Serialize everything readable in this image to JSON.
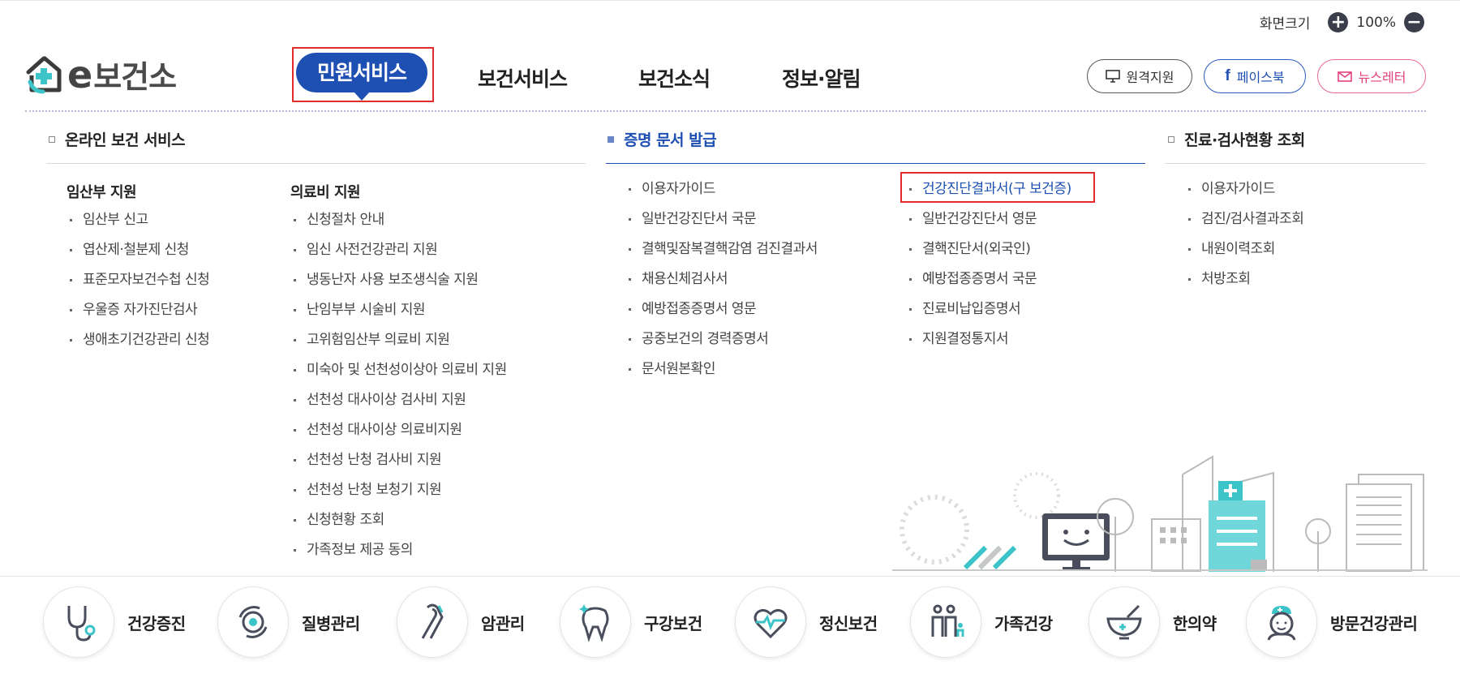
{
  "zoom": {
    "label": "화면크기",
    "plus": "+",
    "value": "100%",
    "minus": "−"
  },
  "logo": {
    "e": "e",
    "text": "보건소"
  },
  "gnb": [
    {
      "label": "민원서비스"
    },
    {
      "label": "보건서비스"
    },
    {
      "label": "보건소식"
    },
    {
      "label": "정보·알림"
    }
  ],
  "top_buttons": {
    "remote": "원격지원",
    "facebook": "페이스북",
    "newsletter": "뉴스레터"
  },
  "sections": {
    "online": {
      "title": "온라인 보건 서비스",
      "col1": {
        "title": "임산부 지원",
        "items": [
          "임산부 신고",
          "엽산제·철분제 신청",
          "표준모자보건수첩 신청",
          "우울증 자가진단검사",
          "생애초기건강관리 신청"
        ]
      },
      "col2": {
        "title": "의료비 지원",
        "items": [
          "신청절차 안내",
          "임신 사전건강관리 지원",
          "냉동난자 사용 보조생식술 지원",
          "난임부부 시술비 지원",
          "고위험임산부 의료비 지원",
          "미숙아 및 선천성이상아 의료비 지원",
          "선천성 대사이상 검사비 지원",
          "선천성 대사이상 의료비지원",
          "선천성 난청 검사비 지원",
          "선천성 난청 보청기 지원",
          "신청현황 조회",
          "가족정보 제공 동의"
        ]
      }
    },
    "cert": {
      "title": "증명 문서 발급",
      "col1": [
        "이용자가이드",
        "일반건강진단서 국문",
        "결핵및잠복결핵감염 검진결과서",
        "채용신체검사서",
        "예방접종증명서 영문",
        "공중보건의 경력증명서",
        "문서원본확인"
      ],
      "col2": [
        "건강진단결과서(구 보건증)",
        "일반건강진단서 영문",
        "결핵진단서(외국인)",
        "예방접종증명서 국문",
        "진료비납입증명서",
        "지원결정통지서"
      ]
    },
    "medical": {
      "title": "진료·검사현황 조회",
      "items": [
        "이용자가이드",
        "검진/검사결과조회",
        "내원이력조회",
        "처방조회"
      ]
    }
  },
  "bottom": [
    "건강증진",
    "질병관리",
    "암관리",
    "구강보건",
    "정신보건",
    "가족건강",
    "한의약",
    "방문건강관리"
  ],
  "colors": {
    "primary": "#1e4fb2",
    "highlight_border": "#e32b2b",
    "teal": "#3cc4c8"
  }
}
